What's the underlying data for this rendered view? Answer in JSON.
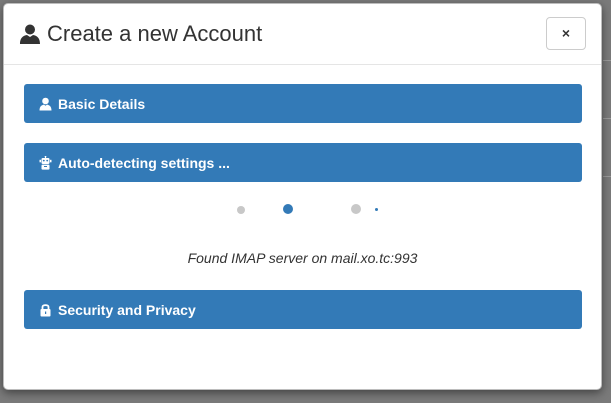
{
  "modal": {
    "title": "Create a new Account",
    "title_icon": "user-icon",
    "close_label": "×"
  },
  "panels": [
    {
      "label": "Basic Details",
      "icon": "user-icon"
    },
    {
      "label": "Auto-detecting settings ...",
      "icon": "robot-icon"
    },
    {
      "label": "Security and Privacy",
      "icon": "lock-icon"
    }
  ],
  "progress": {
    "status": "Found IMAP server on mail.xo.tc:993"
  },
  "colors": {
    "panel": "#337ab7",
    "dot_active": "#337ab7",
    "dot_inactive": "#c8c8c8"
  }
}
